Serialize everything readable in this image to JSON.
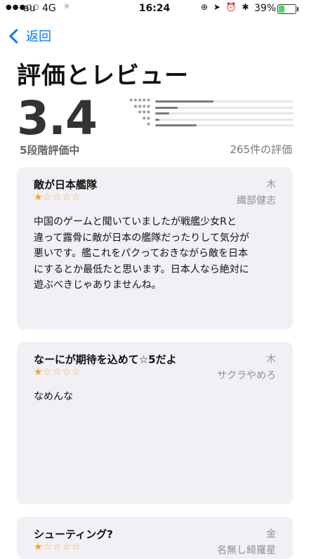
{
  "status_bar": {
    "carrier": "au",
    "network": "4G",
    "time": "16:24",
    "icons": "⊕ ➤ ⏰ ✱",
    "battery_percent": "39%",
    "battery_level": 0.39
  },
  "nav": {
    "back_label": "返回"
  },
  "page_title": "評価とレビュー",
  "summary": {
    "score": "3.4",
    "scale_label": "5段階評価中",
    "count_label": "265件の評価",
    "distribution": [
      {
        "stars": "★★★★★",
        "fraction": 0.42
      },
      {
        "stars": "★★★★",
        "fraction": 0.16
      },
      {
        "stars": "★★★",
        "fraction": 0.1
      },
      {
        "stars": "★★",
        "fraction": 0.03
      },
      {
        "stars": "★",
        "fraction": 0.3
      }
    ]
  },
  "reviews": [
    {
      "title": "敵が日本艦隊",
      "day": "木",
      "author": "織部健志",
      "rating": 1,
      "body": "中国のゲームと聞いていましたが戦艦少女Rと\n違って露骨に敵が日本の艦隊だったりして気分が\n悪いです。艦これをパクっておきながら敵を日本\nにするとか最低たと思います。日本人なら絶対に\n遊ぶべきじゃありませんね。"
    },
    {
      "title": "なーにが期待を込めて☆5だよ",
      "day": "木",
      "author": "サクラやめろ",
      "rating": 1,
      "body": "なめんな"
    },
    {
      "title": "シューティング?",
      "day": "金",
      "author": "名無し綺羅星",
      "rating": 1,
      "body": ""
    }
  ]
}
